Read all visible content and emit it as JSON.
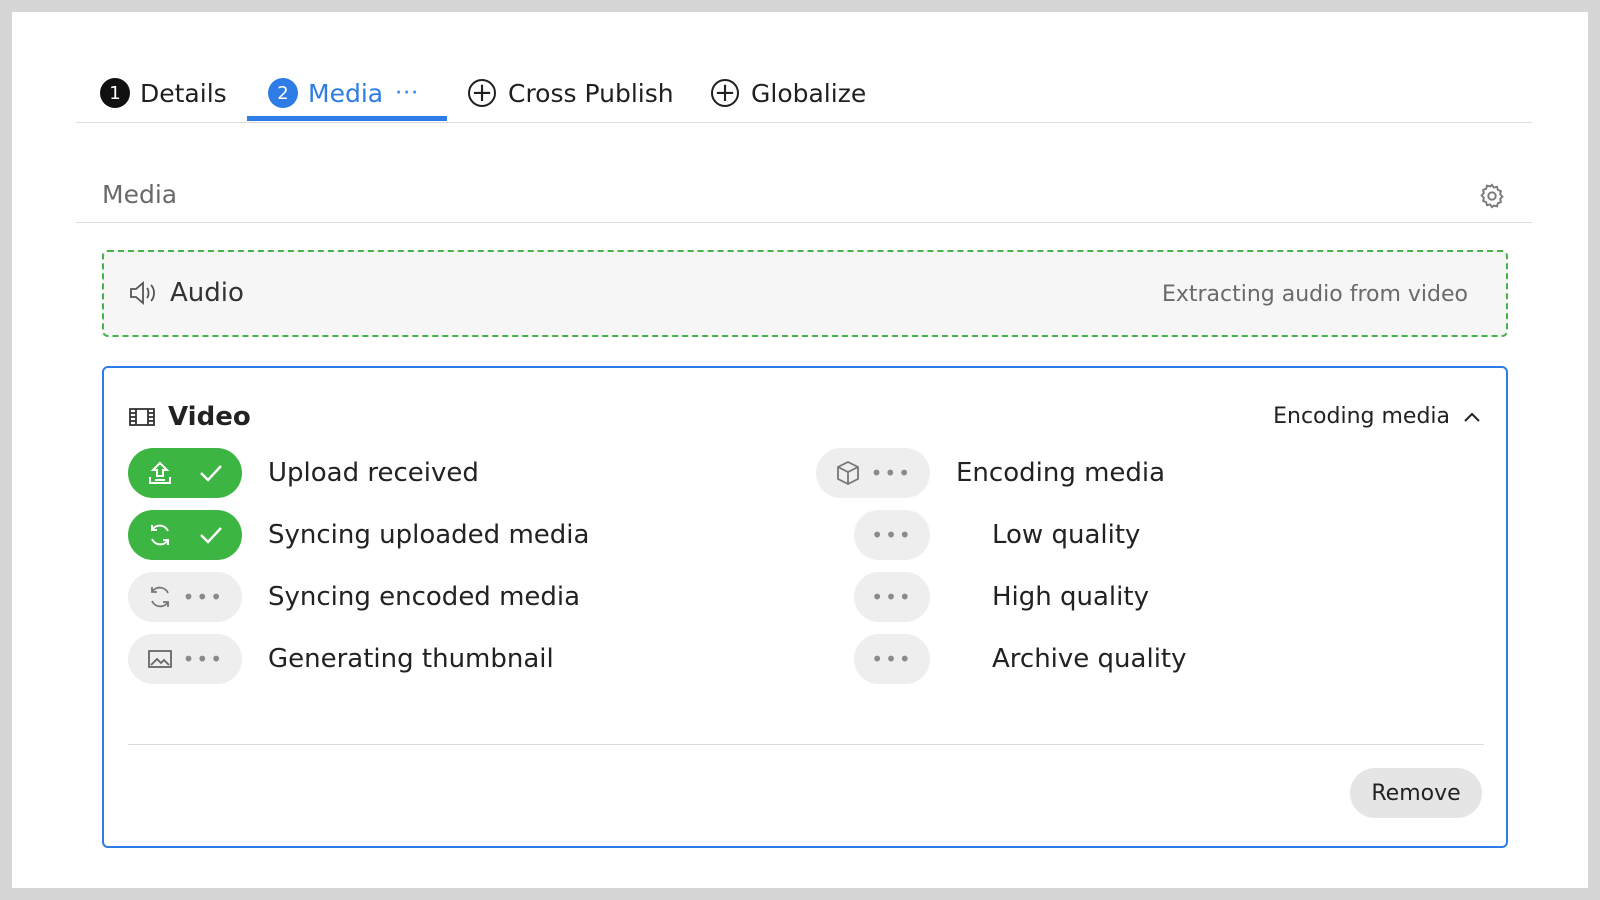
{
  "tabs": [
    {
      "number": "1",
      "label": "Details"
    },
    {
      "number": "2",
      "label": "Media",
      "dots": "···"
    },
    {
      "label": "Cross Publish",
      "icon": "plus-circle-icon"
    },
    {
      "label": "Globalize",
      "icon": "plus-circle-icon"
    }
  ],
  "media": {
    "title": "Media",
    "settings_icon": "gear-icon"
  },
  "audio": {
    "title": "Audio",
    "status": "Extracting audio from video",
    "icon": "speaker-icon"
  },
  "video": {
    "title": "Video",
    "icon": "film-icon",
    "encode_toggle": "Encoding media",
    "left_steps": [
      {
        "label": "Upload received",
        "state": "done",
        "icon": "upload-icon"
      },
      {
        "label": "Syncing uploaded media",
        "state": "done",
        "icon": "sync-icon"
      },
      {
        "label": "Syncing encoded media",
        "state": "pending",
        "icon": "sync-icon"
      },
      {
        "label": "Generating thumbnail",
        "state": "pending",
        "icon": "image-icon"
      }
    ],
    "right_steps": [
      {
        "label": "Encoding media",
        "state": "pending",
        "icon": "cube-icon"
      },
      {
        "label": "Low quality",
        "state": "pending"
      },
      {
        "label": "High quality",
        "state": "pending"
      },
      {
        "label": "Archive quality",
        "state": "pending"
      }
    ],
    "ellipsis": "•••",
    "remove_label": "Remove"
  },
  "colors": {
    "accent": "#2e7ce6",
    "success": "#3db542",
    "pending": "#eeeeee"
  }
}
